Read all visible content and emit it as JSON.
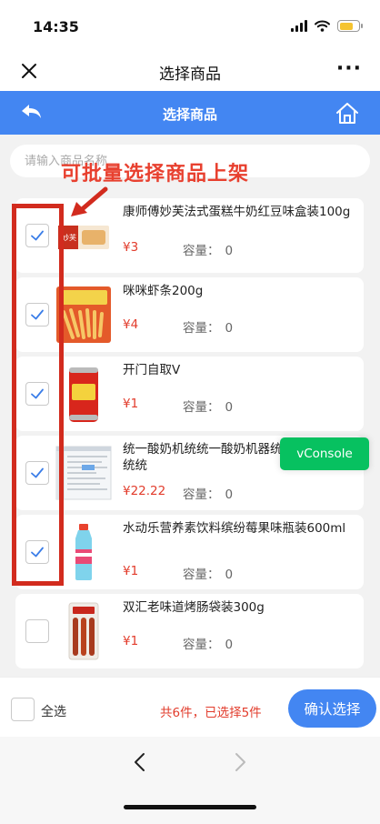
{
  "status_bar": {
    "time": "14:35"
  },
  "title_bar": {
    "title": "选择商品"
  },
  "nav": {
    "title": "选择商品"
  },
  "search": {
    "placeholder": "请输入商品名称"
  },
  "annotation": {
    "text": "可批量选择商品上架"
  },
  "stock_label": "容量：",
  "products": [
    {
      "name": "康师傅妙芙法式蛋糕牛奶红豆味盒装100g",
      "price": "¥3",
      "stock": "0",
      "checked": true,
      "thumb": "cake-box"
    },
    {
      "name": "咪咪虾条200g",
      "price": "¥4",
      "stock": "0",
      "checked": true,
      "thumb": "shrimp-snack"
    },
    {
      "name": "开门自取V",
      "price": "¥1",
      "stock": "0",
      "checked": true,
      "thumb": "red-can"
    },
    {
      "name": "统一酸奶机统统一酸奶机器统一酸奶机器统统",
      "price": "¥22.22",
      "stock": "0",
      "checked": true,
      "thumb": "screenshot"
    },
    {
      "name": "水动乐营养素饮料缤纷莓果味瓶装600ml",
      "price": "¥1",
      "stock": "0",
      "checked": true,
      "thumb": "drink-bottle"
    },
    {
      "name": "双汇老味道烤肠袋装300g",
      "price": "¥1",
      "stock": "0",
      "checked": false,
      "thumb": "sausage-pack"
    }
  ],
  "vconsole": {
    "label": "vConsole"
  },
  "footer": {
    "select_all": "全选",
    "summary": "共6件，已选择5件",
    "confirm": "确认选择"
  },
  "colors": {
    "accent": "#4386f2",
    "price": "#e23c2c",
    "annotation": "#e8402f",
    "vconsole": "#07c160"
  }
}
